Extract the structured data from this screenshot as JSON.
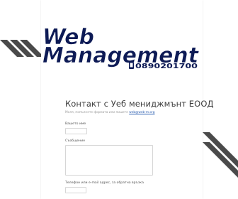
{
  "logo": {
    "line1": "Web",
    "line2": "Management",
    "phone": "0890201700"
  },
  "form": {
    "title": "Контакт с Уеб мениджмънт ЕООД",
    "subtitle_prefix": "Моля, попълнете формата или пишете",
    "subtitle_email": "web@web-m.org",
    "name_label": "Вашето име",
    "message_label": "Съобщение",
    "contact_label": "Телефон или e-mail адрес, за обратна връзка"
  },
  "colors": {
    "logo_navy": "#0d1a55",
    "stripe_gray": "#4a4a4a",
    "link_blue": "#2a5db0"
  }
}
